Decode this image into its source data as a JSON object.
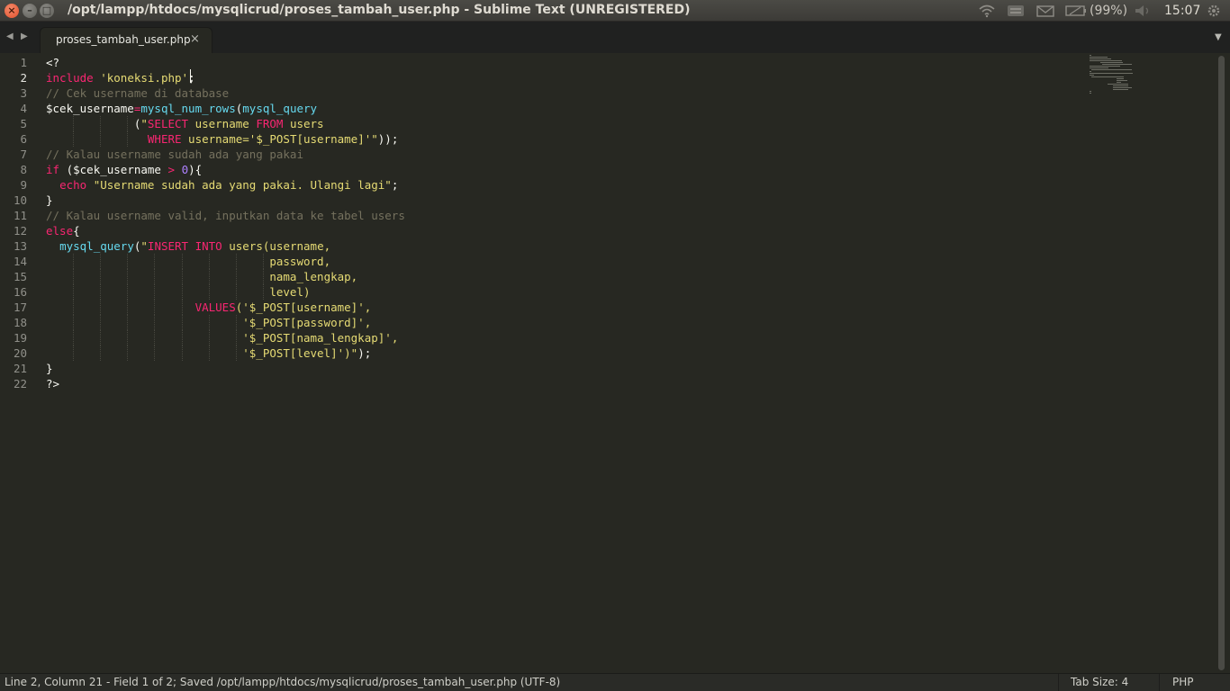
{
  "window": {
    "title": "/opt/lampp/htdocs/mysqlicrud/proses_tambah_user.php - Sublime Text (UNREGISTERED)",
    "close_glyph": "×",
    "minimize_glyph": "–",
    "maximize_glyph": "□"
  },
  "tray": {
    "battery_text": "(99%)",
    "clock": "15:07",
    "icons": [
      "wifi-icon",
      "keyboard-icon",
      "mail-icon",
      "battery-icon",
      "volume-icon",
      "gear-icon"
    ]
  },
  "tabs": {
    "back_glyph": "◀",
    "forward_glyph": "▶",
    "active_label": "proses_tambah_user.php",
    "close_glyph": "×",
    "dropdown_glyph": "▼"
  },
  "editor": {
    "active_line": 2,
    "line_numbers": [
      "1",
      "2",
      "3",
      "4",
      "5",
      "6",
      "7",
      "8",
      "9",
      "10",
      "11",
      "12",
      "13",
      "14",
      "15",
      "16",
      "17",
      "18",
      "19",
      "20",
      "21",
      "22"
    ],
    "lines": [
      "<?",
      "include 'koneksi.php';",
      "// Cek username di database",
      "$cek_username=mysql_num_rows(mysql_query",
      "             (\"SELECT username FROM users",
      "               WHERE username='$_POST[username]'\"));",
      "// Kalau username sudah ada yang pakai",
      "if ($cek_username > 0){",
      "  echo \"Username sudah ada yang pakai. Ulangi lagi\";",
      "}",
      "// Kalau username valid, inputkan data ke tabel users",
      "else{",
      "  mysql_query(\"INSERT INTO users(username,",
      "                                 password,",
      "                                 nama_lengkap,",
      "                                 level)",
      "                      VALUES('$_POST[username]',",
      "                             '$_POST[password]',",
      "                             '$_POST[nama_lengkap]',",
      "                             '$_POST[level]')\");",
      "}",
      "?>"
    ]
  },
  "colors": {
    "keyword": "#f92672",
    "string": "#e6db74",
    "function": "#66d9ef",
    "comment": "#75715e",
    "number": "#ae81ff",
    "background": "#272822",
    "foreground": "#f8f8f2"
  },
  "status": {
    "text": "Line 2, Column 21 - Field 1 of 2; Saved /opt/lampp/htdocs/mysqlicrud/proses_tambah_user.php (UTF-8)",
    "tab_size": "Tab Size: 4",
    "syntax": "PHP"
  }
}
